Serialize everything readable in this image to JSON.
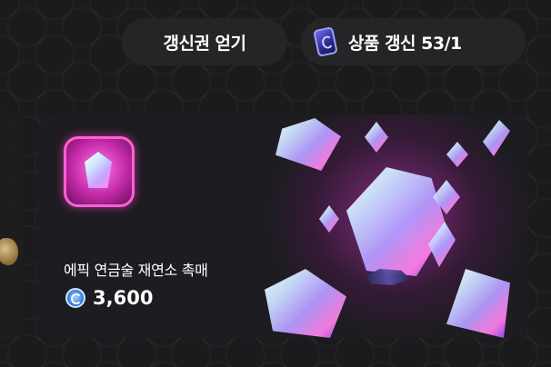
{
  "header": {
    "get_ticket_label": "갱신권 얻기",
    "refresh_label": "상품 갱신 53/1",
    "refresh_icon": "ticket-icon"
  },
  "product": {
    "name": "에픽 연금술 재연소 촉매",
    "price": "3,600",
    "currency_icon": "coin-icon",
    "item_icon": "crystal-catalyst-icon",
    "accent_color": "#e03cd2"
  }
}
